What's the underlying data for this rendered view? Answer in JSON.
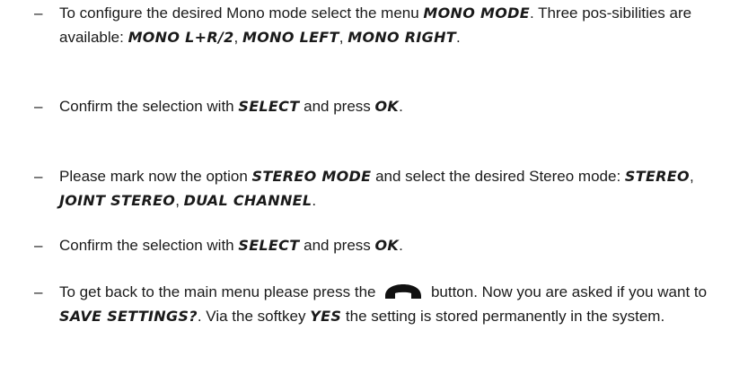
{
  "bullet": "–",
  "items": [
    {
      "segments": [
        {
          "t": "text",
          "v": "To configure the desired Mono mode select the menu "
        },
        {
          "t": "key",
          "v": "MONO MODE"
        },
        {
          "t": "text",
          "v": ". Three pos-sibilities are available: "
        },
        {
          "t": "key",
          "v": "MONO L+R/2"
        },
        {
          "t": "text",
          "v": ", "
        },
        {
          "t": "key",
          "v": "MONO LEFT"
        },
        {
          "t": "text",
          "v": ", "
        },
        {
          "t": "key",
          "v": "MONO RIGHT"
        },
        {
          "t": "text",
          "v": "."
        }
      ]
    },
    {
      "segments": [
        {
          "t": "text",
          "v": "Confirm the selection with "
        },
        {
          "t": "key",
          "v": "SELECT"
        },
        {
          "t": "text",
          "v": " and press "
        },
        {
          "t": "key",
          "v": "OK"
        },
        {
          "t": "text",
          "v": "."
        }
      ]
    },
    {
      "segments": [
        {
          "t": "text",
          "v": "Please mark now the option "
        },
        {
          "t": "key",
          "v": "STEREO MODE"
        },
        {
          "t": "text",
          "v": " and select the desired Stereo mode: "
        },
        {
          "t": "key",
          "v": "STEREO"
        },
        {
          "t": "text",
          "v": ", "
        },
        {
          "t": "key",
          "v": "JOINT STEREO"
        },
        {
          "t": "text",
          "v": ", "
        },
        {
          "t": "key",
          "v": "DUAL CHANNEL"
        },
        {
          "t": "text",
          "v": "."
        }
      ]
    },
    {
      "segments": [
        {
          "t": "text",
          "v": "Confirm the selection with "
        },
        {
          "t": "key",
          "v": "SELECT"
        },
        {
          "t": "text",
          "v": " and press "
        },
        {
          "t": "key",
          "v": "OK"
        },
        {
          "t": "text",
          "v": "."
        }
      ]
    },
    {
      "segments": [
        {
          "t": "text",
          "v": "To get back to the main menu please press the "
        },
        {
          "t": "icon",
          "v": "phone-hang-up-icon"
        },
        {
          "t": "text",
          "v": " button. Now you are asked if you want to "
        },
        {
          "t": "key",
          "v": "SAVE SETTINGS?"
        },
        {
          "t": "text",
          "v": ". Via the softkey "
        },
        {
          "t": "key",
          "v": "YES"
        },
        {
          "t": "text",
          "v": " the setting is stored permanently in the system."
        }
      ]
    }
  ]
}
